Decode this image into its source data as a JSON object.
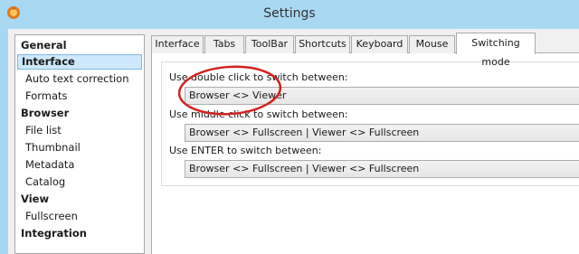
{
  "window": {
    "title": "Settings"
  },
  "sidebar": {
    "items": [
      {
        "label": "General",
        "level": "top"
      },
      {
        "label": "Interface",
        "level": "top",
        "selected": true
      },
      {
        "label": "Auto text correction",
        "level": "child"
      },
      {
        "label": "Formats",
        "level": "child"
      },
      {
        "label": "Browser",
        "level": "top"
      },
      {
        "label": "File list",
        "level": "child"
      },
      {
        "label": "Thumbnail",
        "level": "child"
      },
      {
        "label": "Metadata",
        "level": "child"
      },
      {
        "label": "Catalog",
        "level": "child"
      },
      {
        "label": "View",
        "level": "top"
      },
      {
        "label": "Fullscreen",
        "level": "child"
      },
      {
        "label": "Integration",
        "level": "top"
      }
    ]
  },
  "tabs": [
    {
      "label": "Interface"
    },
    {
      "label": "Tabs"
    },
    {
      "label": "ToolBar"
    },
    {
      "label": "Shortcuts"
    },
    {
      "label": "Keyboard"
    },
    {
      "label": "Mouse"
    },
    {
      "label": "Switching mode",
      "active": true
    }
  ],
  "switching": {
    "double_click_label": "Use double click to switch between:",
    "double_click_value": "Browser <> Viewer",
    "middle_click_label": "Use middle click to switch between:",
    "middle_click_value": "Browser <> Fullscreen | Viewer <> Fullscreen",
    "enter_label": "Use ENTER to switch between:",
    "enter_value": "Browser <> Fullscreen | Viewer <> Fullscreen"
  },
  "colors": {
    "titlebar": "#a9d8f3",
    "selection": "#cde8fa",
    "annotation": "#d42020"
  }
}
